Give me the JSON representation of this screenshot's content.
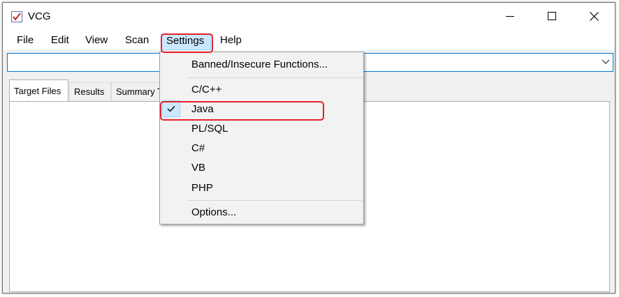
{
  "window": {
    "title": "VCG"
  },
  "menubar": {
    "items": [
      {
        "label": "File"
      },
      {
        "label": "Edit"
      },
      {
        "label": "View"
      },
      {
        "label": "Scan"
      },
      {
        "label": "Settings",
        "state": "open"
      },
      {
        "label": "Help"
      }
    ]
  },
  "combo": {
    "value": ""
  },
  "tabs": [
    {
      "label": "Target Files",
      "selected": true
    },
    {
      "label": "Results"
    },
    {
      "label": "Summary T"
    }
  ],
  "settings_menu": {
    "banned": "Banned/Insecure Functions...",
    "languages": [
      {
        "label": "C/C++",
        "checked": false
      },
      {
        "label": "Java",
        "checked": true
      },
      {
        "label": "PL/SQL",
        "checked": false
      },
      {
        "label": "C#",
        "checked": false
      },
      {
        "label": "VB",
        "checked": false
      },
      {
        "label": "PHP",
        "checked": false
      }
    ],
    "options": "Options..."
  },
  "annotations": {
    "highlight_color": "#e8212b"
  },
  "colors": {
    "menu_hover": "#cce8ff",
    "combo_border": "#0078d7"
  }
}
